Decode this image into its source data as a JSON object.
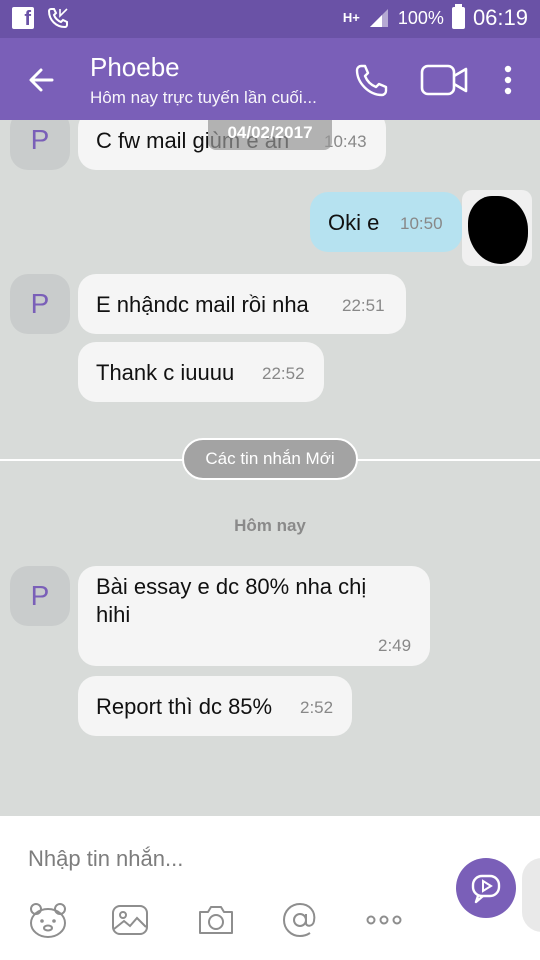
{
  "status_bar": {
    "network": "H+",
    "battery": "100%",
    "time": "06:19"
  },
  "header": {
    "contact_name": "Phoebe",
    "contact_status": "Hôm nay trực tuyến lần cuối..."
  },
  "conversation": {
    "date_pill": "04/02/2017",
    "new_messages_label": "Các tin nhắn Mới",
    "today_label": "Hôm nay",
    "avatar_initial": "P",
    "messages": [
      {
        "text": "C fw mail giùm e an",
        "time": "10:43",
        "direction": "incoming"
      },
      {
        "text": "Oki e",
        "time": "10:50",
        "direction": "outgoing"
      },
      {
        "text": "E nhậndc mail rồi nha",
        "time": "22:51",
        "direction": "incoming"
      },
      {
        "text": "Thank c iuuuu",
        "time": "22:52",
        "direction": "incoming"
      },
      {
        "text_line1": "Bài essay e dc 80% nha chị",
        "text_line2": "hihi",
        "time": "2:49",
        "direction": "incoming"
      },
      {
        "text": "Report thì dc 85%",
        "time": "2:52",
        "direction": "incoming"
      }
    ]
  },
  "composer": {
    "placeholder": "Nhập tin nhắn..."
  },
  "colors": {
    "status_bar": "#6a52a6",
    "header": "#7a5fb8",
    "chat_background": "#d8dbd9",
    "incoming_bubble": "#f5f5f5",
    "outgoing_bubble": "#b6e2f0"
  }
}
